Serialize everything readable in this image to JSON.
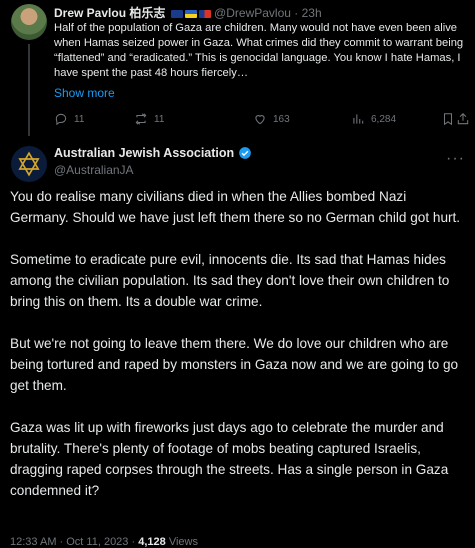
{
  "parent_tweet": {
    "author_name": "Drew Pavlou 柏乐志",
    "flags": [
      "australia-flag",
      "ukraine-flag",
      "taiwan-flag"
    ],
    "handle": "@DrewPavlou",
    "separator": "·",
    "time": "23h",
    "text": "Half of the population of Gaza are children. Many would not have even been alive when Hamas seized power in Gaza. What crimes did they commit to warrant being “flattened” and “eradicated.” This is genocidal language. You know I hate Hamas, I have spent the past 48 hours fiercely…",
    "show_more": "Show more",
    "actions": {
      "replies": "11",
      "reposts": "11",
      "likes": "163",
      "views": "6,284"
    }
  },
  "main_tweet": {
    "author_name": "Australian Jewish Association",
    "handle": "@AustralianJA",
    "paragraphs": [
      "You do realise many civilians died in when the Allies bombed Nazi Germany. Should we have just left them there so no German child got hurt.",
      "Sometime to eradicate pure evil, innocents die. Its sad that Hamas hides among the civilian population. Its sad they don't love their own children to bring this on them. Its a double war crime.",
      "But we're not going to leave them there. We do love our children who are being tortured and raped by monsters in Gaza now and we are going to go get them.",
      "Gaza was lit up with fireworks just days ago to celebrate the murder and brutality. There's plenty of footage of mobs beating captured Israelis, dragging raped corpses through the streets.  Has a single person in Gaza condemned it?"
    ],
    "timestamp": "12:33 AM · Oct 11, 2023",
    "separator": "·",
    "views_count": "4,128",
    "views_label": "Views"
  },
  "colors": {
    "background": "#000000",
    "text": "#e7e9ea",
    "muted": "#71767b",
    "accent": "#1d9bf0"
  }
}
